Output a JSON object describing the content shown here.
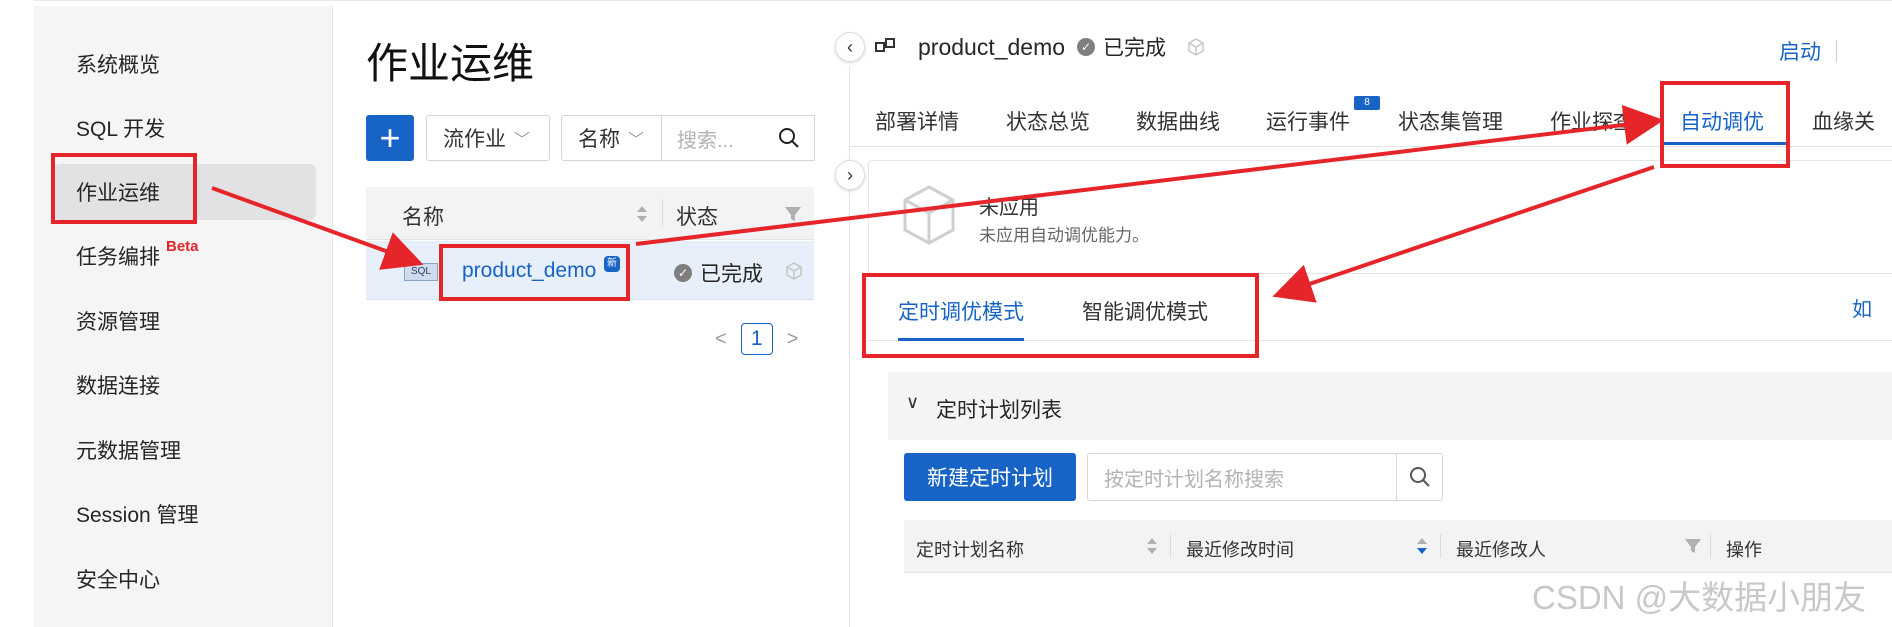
{
  "sidebar": {
    "items": [
      {
        "label": "系统概览"
      },
      {
        "label": "SQL 开发"
      },
      {
        "label": "作业运维"
      },
      {
        "label": "任务编排",
        "badge": "Beta"
      },
      {
        "label": "资源管理"
      },
      {
        "label": "数据连接"
      },
      {
        "label": "元数据管理"
      },
      {
        "label": "Session 管理"
      },
      {
        "label": "安全中心"
      }
    ],
    "active_index": 2
  },
  "jobs": {
    "title": "作业运维",
    "filter_type": "流作业",
    "filter_field": "名称",
    "search_placeholder": "搜索...",
    "columns": [
      "名称",
      "状态"
    ],
    "rows": [
      {
        "type_tag": "SQL",
        "name": "product_demo",
        "new_badge": "新",
        "status": "已完成"
      }
    ],
    "page": "1"
  },
  "detail": {
    "job_name": "product_demo",
    "status": "已完成",
    "start_label": "启动",
    "tabs": [
      "部署详情",
      "状态总览",
      "数据曲线",
      "运行事件",
      "状态集管理",
      "作业探查",
      "自动调优",
      "血缘关"
    ],
    "active_tab": "自动调优",
    "events_badge": "8",
    "tuning": {
      "title": "未应用",
      "subtitle": "未应用自动调优能力。",
      "mode_tabs": [
        "定时调优模式",
        "智能调优模式"
      ],
      "active_mode": "定时调优模式",
      "edge_text": "如",
      "section_title": "定时计划列表",
      "new_plan_label": "新建定时计划",
      "search_placeholder": "按定时计划名称搜索",
      "columns": [
        "定时计划名称",
        "最近修改时间",
        "最近修改人",
        "操作"
      ]
    }
  },
  "watermark": "CSDN @大数据小朋友",
  "colors": {
    "accent": "#1763c6",
    "annotation": "#e5252a",
    "sidebar_bg": "#f5f5f6"
  }
}
